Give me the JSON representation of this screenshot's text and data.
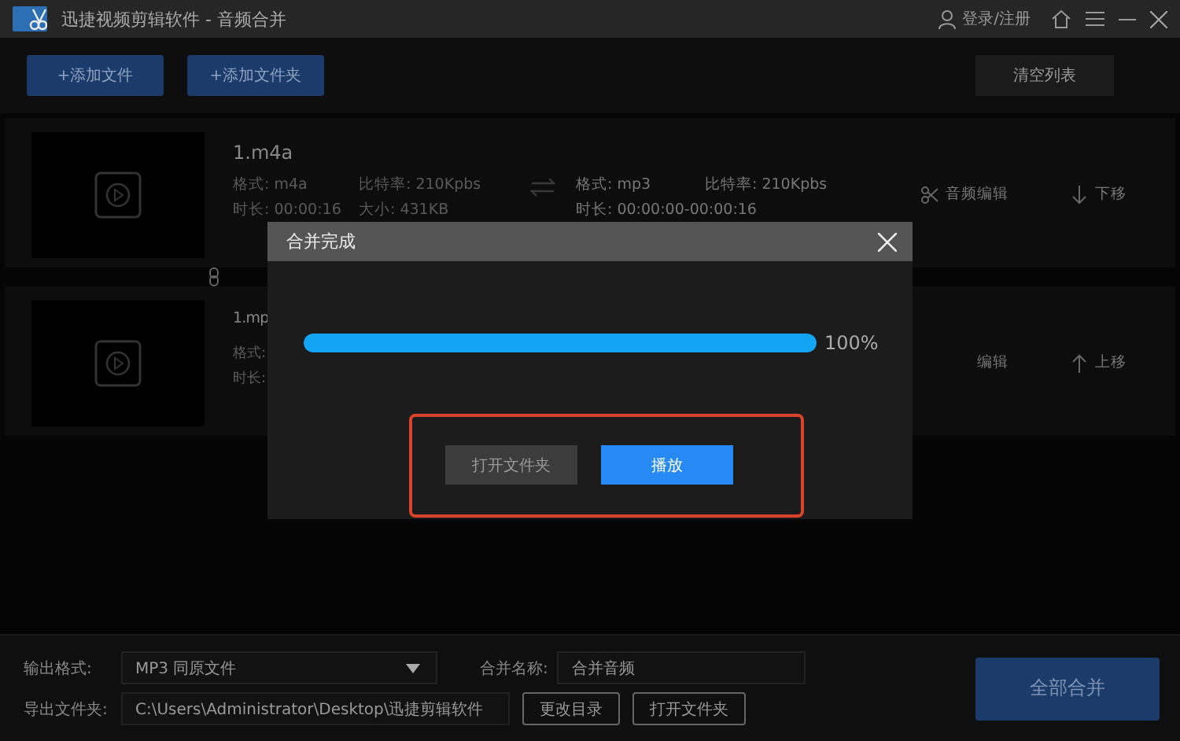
{
  "window": {
    "title": "迅捷视频剪辑软件 - 音频合并",
    "login": "登录/注册"
  },
  "toolbar": {
    "add_buttons": [
      "+添加文件",
      "+添加文件夹"
    ],
    "clear_button": "清空列表"
  },
  "files": [
    {
      "name": "1.m4a",
      "source": [
        "格式: m4a",
        "比特率: 210Kpbs",
        "时长: 00:00:16",
        "大小: 431KB"
      ],
      "output": [
        "格式: mp3",
        "比特率: 210Kpbs",
        "时长: 00:00:00-00:00:16"
      ],
      "edit": "音频编辑",
      "move": {
        "kind": "down",
        "label": "下移"
      }
    },
    {
      "name": "1.mp",
      "source": [
        "格式:",
        "时长:"
      ],
      "edit": "编辑",
      "move": {
        "kind": "up",
        "label": "上移"
      }
    }
  ],
  "dialog": {
    "title": "合并完成",
    "progress": {
      "level": 1,
      "reading": "100%"
    },
    "buttons": [
      {
        "kind": "secondary",
        "label": "打开文件夹"
      },
      {
        "kind": "primary",
        "label": "播放"
      }
    ]
  },
  "bottom": {
    "format_label": "输出格式:",
    "format_value": "MP3 同原文件",
    "name_label": "合并名称:",
    "name_value": "合并音频",
    "folder_label": "导出文件夹:",
    "folder_value": "C:\\Users\\Administrator\\Desktop\\迅捷剪辑软件",
    "change_dir": "更改目录",
    "open_folder": "打开文件夹",
    "merge_all": "全部合并"
  }
}
